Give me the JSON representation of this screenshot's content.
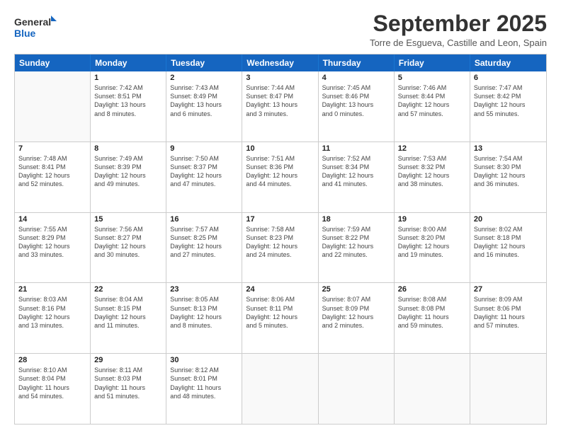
{
  "logo": {
    "line1": "General",
    "line2": "Blue"
  },
  "title": "September 2025",
  "location": "Torre de Esgueva, Castille and Leon, Spain",
  "days_of_week": [
    "Sunday",
    "Monday",
    "Tuesday",
    "Wednesday",
    "Thursday",
    "Friday",
    "Saturday"
  ],
  "rows": [
    [
      {
        "day": "",
        "info": ""
      },
      {
        "day": "1",
        "info": "Sunrise: 7:42 AM\nSunset: 8:51 PM\nDaylight: 13 hours\nand 8 minutes."
      },
      {
        "day": "2",
        "info": "Sunrise: 7:43 AM\nSunset: 8:49 PM\nDaylight: 13 hours\nand 6 minutes."
      },
      {
        "day": "3",
        "info": "Sunrise: 7:44 AM\nSunset: 8:47 PM\nDaylight: 13 hours\nand 3 minutes."
      },
      {
        "day": "4",
        "info": "Sunrise: 7:45 AM\nSunset: 8:46 PM\nDaylight: 13 hours\nand 0 minutes."
      },
      {
        "day": "5",
        "info": "Sunrise: 7:46 AM\nSunset: 8:44 PM\nDaylight: 12 hours\nand 57 minutes."
      },
      {
        "day": "6",
        "info": "Sunrise: 7:47 AM\nSunset: 8:42 PM\nDaylight: 12 hours\nand 55 minutes."
      }
    ],
    [
      {
        "day": "7",
        "info": "Sunrise: 7:48 AM\nSunset: 8:41 PM\nDaylight: 12 hours\nand 52 minutes."
      },
      {
        "day": "8",
        "info": "Sunrise: 7:49 AM\nSunset: 8:39 PM\nDaylight: 12 hours\nand 49 minutes."
      },
      {
        "day": "9",
        "info": "Sunrise: 7:50 AM\nSunset: 8:37 PM\nDaylight: 12 hours\nand 47 minutes."
      },
      {
        "day": "10",
        "info": "Sunrise: 7:51 AM\nSunset: 8:36 PM\nDaylight: 12 hours\nand 44 minutes."
      },
      {
        "day": "11",
        "info": "Sunrise: 7:52 AM\nSunset: 8:34 PM\nDaylight: 12 hours\nand 41 minutes."
      },
      {
        "day": "12",
        "info": "Sunrise: 7:53 AM\nSunset: 8:32 PM\nDaylight: 12 hours\nand 38 minutes."
      },
      {
        "day": "13",
        "info": "Sunrise: 7:54 AM\nSunset: 8:30 PM\nDaylight: 12 hours\nand 36 minutes."
      }
    ],
    [
      {
        "day": "14",
        "info": "Sunrise: 7:55 AM\nSunset: 8:29 PM\nDaylight: 12 hours\nand 33 minutes."
      },
      {
        "day": "15",
        "info": "Sunrise: 7:56 AM\nSunset: 8:27 PM\nDaylight: 12 hours\nand 30 minutes."
      },
      {
        "day": "16",
        "info": "Sunrise: 7:57 AM\nSunset: 8:25 PM\nDaylight: 12 hours\nand 27 minutes."
      },
      {
        "day": "17",
        "info": "Sunrise: 7:58 AM\nSunset: 8:23 PM\nDaylight: 12 hours\nand 24 minutes."
      },
      {
        "day": "18",
        "info": "Sunrise: 7:59 AM\nSunset: 8:22 PM\nDaylight: 12 hours\nand 22 minutes."
      },
      {
        "day": "19",
        "info": "Sunrise: 8:00 AM\nSunset: 8:20 PM\nDaylight: 12 hours\nand 19 minutes."
      },
      {
        "day": "20",
        "info": "Sunrise: 8:02 AM\nSunset: 8:18 PM\nDaylight: 12 hours\nand 16 minutes."
      }
    ],
    [
      {
        "day": "21",
        "info": "Sunrise: 8:03 AM\nSunset: 8:16 PM\nDaylight: 12 hours\nand 13 minutes."
      },
      {
        "day": "22",
        "info": "Sunrise: 8:04 AM\nSunset: 8:15 PM\nDaylight: 12 hours\nand 11 minutes."
      },
      {
        "day": "23",
        "info": "Sunrise: 8:05 AM\nSunset: 8:13 PM\nDaylight: 12 hours\nand 8 minutes."
      },
      {
        "day": "24",
        "info": "Sunrise: 8:06 AM\nSunset: 8:11 PM\nDaylight: 12 hours\nand 5 minutes."
      },
      {
        "day": "25",
        "info": "Sunrise: 8:07 AM\nSunset: 8:09 PM\nDaylight: 12 hours\nand 2 minutes."
      },
      {
        "day": "26",
        "info": "Sunrise: 8:08 AM\nSunset: 8:08 PM\nDaylight: 11 hours\nand 59 minutes."
      },
      {
        "day": "27",
        "info": "Sunrise: 8:09 AM\nSunset: 8:06 PM\nDaylight: 11 hours\nand 57 minutes."
      }
    ],
    [
      {
        "day": "28",
        "info": "Sunrise: 8:10 AM\nSunset: 8:04 PM\nDaylight: 11 hours\nand 54 minutes."
      },
      {
        "day": "29",
        "info": "Sunrise: 8:11 AM\nSunset: 8:03 PM\nDaylight: 11 hours\nand 51 minutes."
      },
      {
        "day": "30",
        "info": "Sunrise: 8:12 AM\nSunset: 8:01 PM\nDaylight: 11 hours\nand 48 minutes."
      },
      {
        "day": "",
        "info": ""
      },
      {
        "day": "",
        "info": ""
      },
      {
        "day": "",
        "info": ""
      },
      {
        "day": "",
        "info": ""
      }
    ]
  ]
}
